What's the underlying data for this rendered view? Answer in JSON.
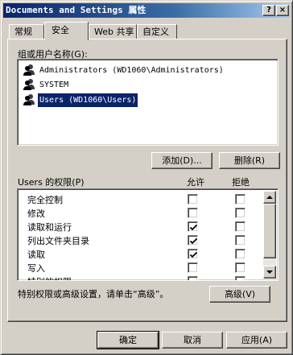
{
  "window": {
    "title": "Documents and Settings 属性"
  },
  "titlebar_buttons": {
    "help": "?",
    "close": "×"
  },
  "tabs": [
    {
      "label": "常规"
    },
    {
      "label": "安全"
    },
    {
      "label": "Web 共享"
    },
    {
      "label": "自定义"
    }
  ],
  "groups": {
    "label": "组或用户名称(G):",
    "users": [
      {
        "name": "Administrators (WD1060\\Administrators)",
        "icon": "user-group-icon",
        "selected": false
      },
      {
        "name": "SYSTEM",
        "icon": "user-group-icon",
        "selected": false
      },
      {
        "name": "Users (WD1060\\Users)",
        "icon": "user-group-icon",
        "selected": true
      }
    ],
    "add_button": "添加(D)...",
    "remove_button": "删除(R)"
  },
  "permissions": {
    "label": "Users 的权限(P)",
    "allow_header": "允许",
    "deny_header": "拒绝",
    "rows": [
      {
        "name": "完全控制",
        "allow": false,
        "deny": false
      },
      {
        "name": "修改",
        "allow": false,
        "deny": false
      },
      {
        "name": "读取和运行",
        "allow": true,
        "deny": false
      },
      {
        "name": "列出文件夹目录",
        "allow": true,
        "deny": false
      },
      {
        "name": "读取",
        "allow": true,
        "deny": false
      },
      {
        "name": "写入",
        "allow": false,
        "deny": false
      },
      {
        "name": "特别的权限",
        "allow": false,
        "deny": false
      }
    ]
  },
  "advanced": {
    "text": "特别权限或高级设置，请单击“高级”。",
    "button": "高级(V)"
  },
  "footer": {
    "ok": "确定",
    "cancel": "取消",
    "apply": "应用(A)"
  },
  "colors": {
    "selection": "#0a246a",
    "titlebar": "#0a246a",
    "face": "#d4d0c8"
  }
}
